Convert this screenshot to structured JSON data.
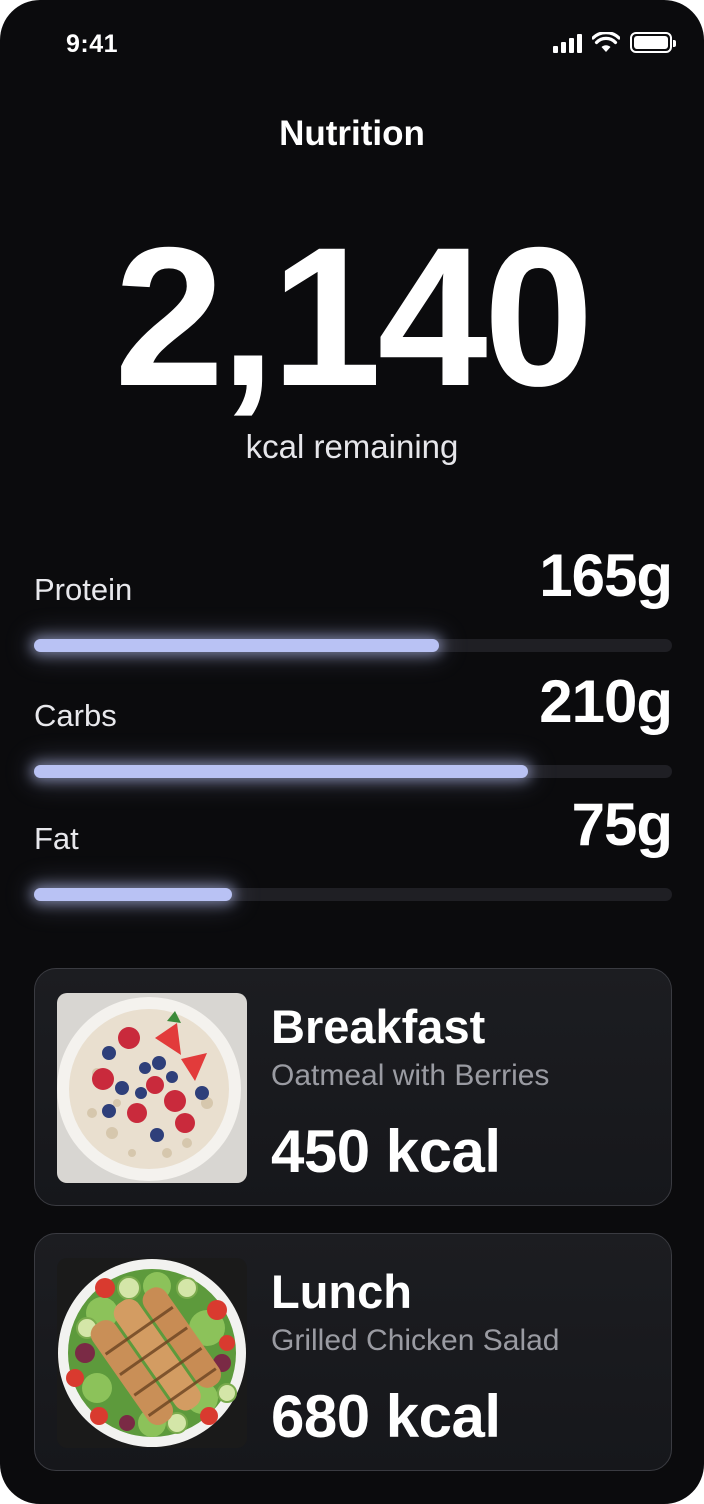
{
  "status_bar": {
    "time": "9:41"
  },
  "header": {
    "title": "Nutrition"
  },
  "summary": {
    "calories": "2,140",
    "caption": "kcal remaining"
  },
  "macros": [
    {
      "label": "Protein",
      "value": "165g",
      "progress": 0.635
    },
    {
      "label": "Carbs",
      "value": "210g",
      "progress": 0.775
    },
    {
      "label": "Fat",
      "value": "75g",
      "progress": 0.31
    }
  ],
  "meals": [
    {
      "name": "Breakfast",
      "description": "Oatmeal with Berries",
      "calories": "450 kcal",
      "image": "oatmeal-berries-bowl"
    },
    {
      "name": "Lunch",
      "description": "Grilled Chicken Salad",
      "calories": "680 kcal",
      "image": "grilled-chicken-salad-bowl"
    }
  ],
  "colors": {
    "background": "#0b0b0d",
    "accent": "#b9c2f4",
    "track": "#1f1f24",
    "card": "#1a1b1f",
    "muted_text": "#9a9ba2"
  }
}
